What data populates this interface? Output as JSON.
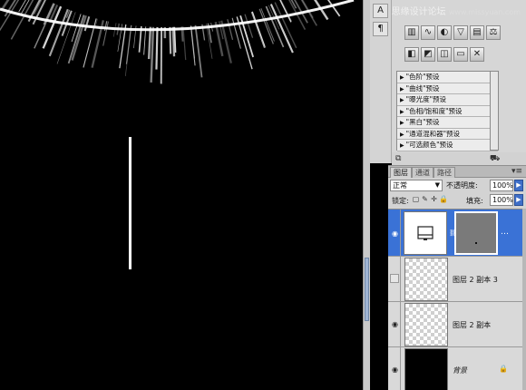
{
  "watermark": {
    "text": "思缘设计论坛",
    "url": "www.missyuan.com"
  },
  "side_strip": {
    "buttons": [
      "¶"
    ]
  },
  "adjustments": {
    "presets": [
      "\"色阶\"预设",
      "\"曲线\"预设",
      "\"曝光度\"预设",
      "\"色相/饱和度\"预设",
      "\"黑白\"预设",
      "\"通道混和器\"预设",
      "\"可选颜色\"预设"
    ]
  },
  "layers_panel": {
    "tabs": [
      "图层",
      "通道",
      "路径"
    ],
    "active_tab": "图层",
    "blend_mode": "正常",
    "opacity_label": "不透明度:",
    "opacity_value": "100%",
    "lock_label": "锁定:",
    "fill_label": "填充:",
    "fill_value": "100%",
    "layers": [
      {
        "name": "",
        "type": "adjustment",
        "visible": true,
        "selected": true
      },
      {
        "name": "图层 2 副本 3",
        "type": "pixel",
        "visible": false,
        "selected": false
      },
      {
        "name": "图层 2 副本",
        "type": "pixel",
        "visible": true,
        "selected": false
      },
      {
        "name": "背景",
        "type": "background",
        "visible": true,
        "selected": false,
        "locked": true
      }
    ]
  },
  "colors": {
    "canvas": "#000000",
    "selection": "#3a72d6",
    "panel": "#d3d3d3"
  }
}
